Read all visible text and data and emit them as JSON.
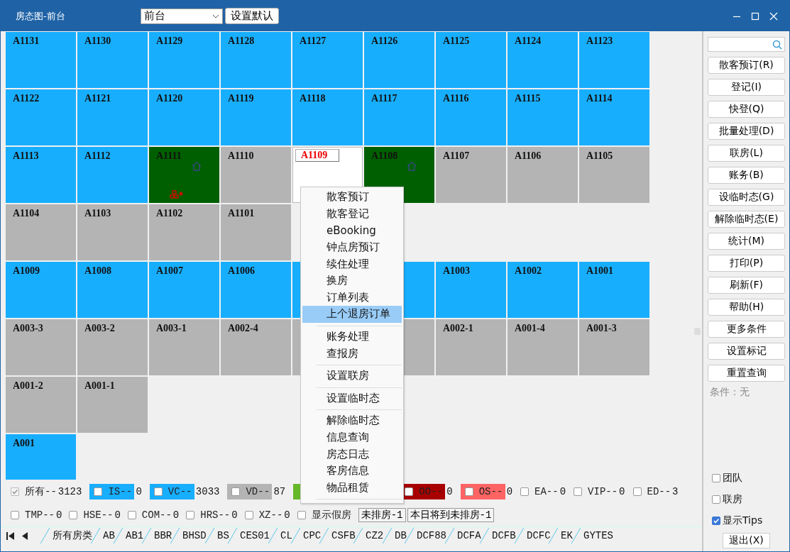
{
  "window": {
    "title": "房态图-前台",
    "view_select": "前台",
    "default_button": "设置默认"
  },
  "room_groups": [
    {
      "rooms": [
        {
          "label": "A1131",
          "color": "#18aefe",
          "selected": false
        },
        {
          "label": "A1130",
          "color": "#18aefe",
          "selected": false
        },
        {
          "label": "A1129",
          "color": "#18aefe",
          "selected": false
        },
        {
          "label": "A1128",
          "color": "#18aefe",
          "selected": false
        },
        {
          "label": "A1127",
          "color": "#18aefe",
          "selected": false
        },
        {
          "label": "A1126",
          "color": "#18aefe",
          "selected": false
        },
        {
          "label": "A1125",
          "color": "#18aefe",
          "selected": false
        },
        {
          "label": "A1124",
          "color": "#18aefe",
          "selected": false
        },
        {
          "label": "A1123",
          "color": "#18aefe",
          "selected": false
        },
        {
          "label": "A1122",
          "color": "#18aefe",
          "selected": false
        },
        {
          "label": "A1121",
          "color": "#18aefe",
          "selected": false
        },
        {
          "label": "A1120",
          "color": "#18aefe",
          "selected": false
        },
        {
          "label": "A1119",
          "color": "#18aefe",
          "selected": false
        },
        {
          "label": "A1118",
          "color": "#18aefe",
          "selected": false
        },
        {
          "label": "A1117",
          "color": "#18aefe",
          "selected": false
        },
        {
          "label": "A1116",
          "color": "#18aefe",
          "selected": false
        },
        {
          "label": "A1115",
          "color": "#18aefe",
          "selected": false
        },
        {
          "label": "A1114",
          "color": "#18aefe",
          "selected": false
        },
        {
          "label": "A1113",
          "color": "#18aefe",
          "selected": false
        },
        {
          "label": "A1112",
          "color": "#18aefe",
          "selected": false
        },
        {
          "label": "A1111",
          "color": "#005f00",
          "selected": false,
          "house_icon": true,
          "linked_icon": true
        },
        {
          "label": "A1110",
          "color": "#b4b4b4",
          "selected": false
        },
        {
          "label": "A1109",
          "selected": true
        },
        {
          "label": "A1108",
          "color": "#005f00",
          "selected": false,
          "house_icon": true
        },
        {
          "label": "A1107",
          "color": "#b4b4b4",
          "selected": false
        },
        {
          "label": "A1106",
          "color": "#b4b4b4",
          "selected": false
        },
        {
          "label": "A1105",
          "color": "#b4b4b4",
          "selected": false
        },
        {
          "label": "A1104",
          "color": "#b4b4b4",
          "selected": false
        },
        {
          "label": "A1103",
          "color": "#b4b4b4",
          "selected": false
        },
        {
          "label": "A1102",
          "color": "#b4b4b4",
          "selected": false
        },
        {
          "label": "A1101",
          "color": "#b4b4b4",
          "selected": false
        }
      ]
    },
    {
      "rooms": [
        {
          "label": "A1009",
          "color": "#18aefe",
          "selected": false
        },
        {
          "label": "A1008",
          "color": "#18aefe",
          "selected": false
        },
        {
          "label": "A1007",
          "color": "#18aefe",
          "selected": false
        },
        {
          "label": "A1006",
          "color": "#18aefe",
          "selected": false
        },
        {
          "color": "#18aefe",
          "selected": false
        },
        {
          "color": "#18aefe",
          "selected": false
        },
        {
          "label": "A1003",
          "color": "#18aefe",
          "selected": false
        },
        {
          "label": "A1002",
          "color": "#18aefe",
          "selected": false
        },
        {
          "label": "A1001",
          "color": "#18aefe",
          "selected": false
        }
      ]
    },
    {
      "rooms": [
        {
          "label": "A003-3",
          "color": "#b4b4b4",
          "selected": false
        },
        {
          "label": "A003-2",
          "color": "#b4b4b4",
          "selected": false
        },
        {
          "label": "A003-1",
          "color": "#b4b4b4",
          "selected": false
        },
        {
          "label": "A002-4",
          "color": "#b4b4b4",
          "selected": false
        },
        {
          "color": "#b4b4b4",
          "selected": false
        },
        {
          "color": "#b4b4b4",
          "selected": false
        },
        {
          "label": "A002-1",
          "color": "#b4b4b4",
          "selected": false
        },
        {
          "label": "A001-4",
          "color": "#b4b4b4",
          "selected": false
        },
        {
          "label": "A001-3",
          "color": "#b4b4b4",
          "selected": false
        },
        {
          "label": "A001-2",
          "color": "#b4b4b4",
          "selected": false
        },
        {
          "label": "A001-1",
          "color": "#b4b4b4",
          "selected": false
        }
      ]
    },
    {
      "rooms": [
        {
          "label": "A001",
          "color": "#18aefe",
          "selected": false
        }
      ]
    }
  ],
  "context_menu": [
    {
      "kind": "item",
      "label": "散客预订",
      "selected": false
    },
    {
      "kind": "item",
      "label": "散客登记",
      "selected": false
    },
    {
      "kind": "item",
      "label": "eBooking",
      "selected": false
    },
    {
      "kind": "item",
      "label": "钟点房预订",
      "selected": false
    },
    {
      "kind": "item",
      "label": "续住处理",
      "selected": false
    },
    {
      "kind": "item",
      "label": "换房",
      "selected": false
    },
    {
      "kind": "item",
      "label": "订单列表",
      "selected": false
    },
    {
      "kind": "item",
      "label": "上个退房订单",
      "selected": true
    },
    {
      "kind": "separator"
    },
    {
      "kind": "item",
      "label": "账务处理",
      "selected": false
    },
    {
      "kind": "item",
      "label": "查报房",
      "selected": false
    },
    {
      "kind": "separator"
    },
    {
      "kind": "item",
      "label": "设置联房",
      "selected": false
    },
    {
      "kind": "separator"
    },
    {
      "kind": "item",
      "label": "设置临时态",
      "selected": false
    },
    {
      "kind": "separator"
    },
    {
      "kind": "item",
      "label": "解除临时态",
      "selected": false
    },
    {
      "kind": "item",
      "label": "信息查询",
      "selected": false
    },
    {
      "kind": "item",
      "label": "房态日志",
      "selected": false
    },
    {
      "kind": "item",
      "label": "客房信息",
      "selected": false
    },
    {
      "kind": "item",
      "label": "物品租赁",
      "selected": false
    },
    {
      "kind": "separator"
    }
  ],
  "legend_row_1": [
    {
      "label": "所有--",
      "count": "3123",
      "checked": true,
      "disabled": true
    },
    {
      "label": "IS--",
      "count": "0",
      "checked": false,
      "color": "#18aefe"
    },
    {
      "label": "VC--",
      "count": "3033",
      "checked": false,
      "color": "#18aefe"
    },
    {
      "label": "VD--",
      "count": "87",
      "checked": false,
      "color": "#b4b4b4"
    },
    {
      "color": "#66b82a"
    },
    {
      "label": "OO--",
      "count": "0",
      "checked": false,
      "color": "#a80000"
    },
    {
      "label": "OS--",
      "count": "0",
      "checked": false,
      "color": "#ff6464"
    },
    {
      "label": "EA--",
      "count": "0",
      "checked": false
    },
    {
      "label": "VIP--",
      "count": "0",
      "checked": false
    },
    {
      "label": "ED--",
      "count": "3",
      "checked": false
    }
  ],
  "legend_row_2": [
    {
      "label": "TMP--",
      "count": "0",
      "checked": false
    },
    {
      "label": "HSE--",
      "count": "0",
      "checked": false
    },
    {
      "label": "COM--",
      "count": "0",
      "checked": false
    },
    {
      "label": "HRS--",
      "count": "0",
      "checked": false
    },
    {
      "label": "XZ--",
      "count": "0",
      "checked": false
    },
    {
      "label": "显示假房",
      "checked": false
    }
  ],
  "unassigned_buttons": [
    "未排房-1",
    "本日将到未排房-1"
  ],
  "room_type_tabs": [
    "所有房类",
    "AB",
    "AB1",
    "BBR",
    "BHSD",
    "BS",
    "CES01",
    "CL",
    "CPC",
    "CSFB",
    "CZ2",
    "DB",
    "DCF88",
    "DCFA",
    "DCFB",
    "DCFC",
    "EK",
    "GYTES"
  ],
  "sidebar": {
    "buttons": [
      "散客预订(R)",
      "登记(I)",
      "快登(Q)",
      "批量处理(D)",
      "联房(L)",
      "账务(B)",
      "设临时态(G)",
      "解除临时态(E)",
      "统计(M)",
      "打印(P)",
      "刷新(F)",
      "帮助(H)",
      "更多条件",
      "设置标记",
      "重置查询"
    ],
    "condition": "条件：无",
    "options": [
      {
        "label": "团队",
        "checked": false
      },
      {
        "label": "联房",
        "checked": false
      },
      {
        "label": "显示Tips",
        "checked": true
      }
    ],
    "exit_button": "退出(X)"
  }
}
